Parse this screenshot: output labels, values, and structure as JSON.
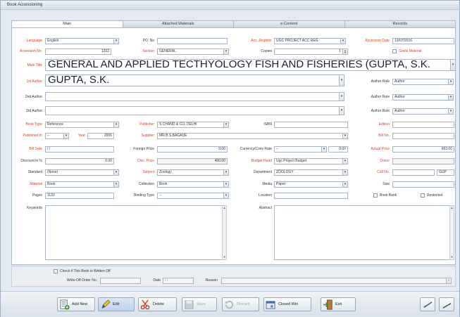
{
  "window": {
    "title": "Book Accessioning"
  },
  "tabs": [
    "Main",
    "Attached Materials",
    "e-Content",
    "Records"
  ],
  "fields": {
    "language": {
      "label": "Language",
      "value": "English"
    },
    "po_no": {
      "label": "PO. No",
      "value": ""
    },
    "acc_register": {
      "label": "Acc. Register",
      "value": "UGC PROJECT ACC REG"
    },
    "accession_date": {
      "label": "Accession Date",
      "value": "13/07/2016"
    },
    "accession_no": {
      "label": "Accession No.",
      "value": "1202"
    },
    "section": {
      "label": "Section",
      "value": "GENERAL"
    },
    "copies": {
      "label": "Copies",
      "value": "1"
    },
    "gratis_material": {
      "label": "Gratis Material"
    },
    "main_title": {
      "label": "Main Title",
      "value": "GENERAL AND APPLIED TECTHYOLOGY FISH AND FISHERIES (GUPTA, S.K."
    },
    "author1": {
      "label": "1st Author",
      "value": "GUPTA, S.K."
    },
    "author2": {
      "label": "2nd Author",
      "value": ""
    },
    "author3": {
      "label": "3rd Author",
      "value": ""
    },
    "author_role1": {
      "label": "Author Role",
      "value": "Author"
    },
    "author_role2": {
      "label": "Author Role",
      "value": "Author"
    },
    "author_role3": {
      "label": "Author Role",
      "value": "Author"
    },
    "book_type": {
      "label": "Book Type",
      "value": "Reference"
    },
    "publisher": {
      "label": "Publisher",
      "value": "S.CHAND & CO. DELHI"
    },
    "isbn": {
      "label": "ISBN",
      "value": ""
    },
    "edition": {
      "label": "Edition",
      "value": ""
    },
    "published_in": {
      "label": "Published In",
      "value": "--"
    },
    "year": {
      "label": "Year",
      "value": "2006"
    },
    "supplier": {
      "label": "Supplier",
      "value": "MR.B.S.BAGADE"
    },
    "bill_no": {
      "label": "Bill No.",
      "value": ""
    },
    "bill_date": {
      "label": "Bill Date",
      "value": "/ /"
    },
    "foreign_price": {
      "label": "Foreign Price",
      "value": "0.00"
    },
    "currency_conv_rate": {
      "label": "Currency/Conv Rate",
      "value": "--",
      "rate": "0.00"
    },
    "actual_price": {
      "label": "Actual Price",
      "value": "663.00"
    },
    "discount": {
      "label": "Discount in %",
      "value": "0.00"
    },
    "disc_price": {
      "label": "Disc. Price",
      "value": "400.00"
    },
    "budget_head": {
      "label": "Budget Head",
      "value": "Ugc Project Budget"
    },
    "donor": {
      "label": "Donor",
      "value": ""
    },
    "standard": {
      "label": "Standard",
      "value": "(None)"
    },
    "subject": {
      "label": "Subject",
      "value": "Zoology"
    },
    "department": {
      "label": "Department",
      "value": "ZOOLOGY"
    },
    "call_no": {
      "label": "Call No.",
      "value": "",
      "suffix": "GUP"
    },
    "material": {
      "label": "Material",
      "value": "Book"
    },
    "collection": {
      "label": "Collection",
      "value": "Book"
    },
    "media": {
      "label": "Media",
      "value": "Paper"
    },
    "size": {
      "label": "Size",
      "value": ""
    },
    "pages": {
      "label": "Pages",
      "value": "1133"
    },
    "binding_type": {
      "label": "Binding Type",
      "value": "--"
    },
    "location": {
      "label": "Location",
      "value": ""
    },
    "book_bank": {
      "label": "Book Bank"
    },
    "restricted": {
      "label": "Restricted"
    },
    "keywords": {
      "label": "Keywords",
      "value": ""
    },
    "abstract": {
      "label": "Abstract",
      "value": ""
    }
  },
  "writeoff": {
    "check_label": "Check if This Book is Written Off",
    "no_label": "Write-Off Order No.",
    "no_value": "",
    "date_label": "Date",
    "date_value": "/ /",
    "reason_label": "Reason",
    "reason_value": ""
  },
  "buttons": [
    {
      "label": "Add New",
      "icon": "add-new-icon",
      "state": "enabled"
    },
    {
      "label": "Edit",
      "icon": "edit-pencil-icon",
      "state": "pressed"
    },
    {
      "label": "Delete",
      "icon": "delete-scissors-icon",
      "state": "enabled"
    },
    {
      "label": "Save",
      "icon": "save-disk-icon",
      "state": "disabled"
    },
    {
      "label": "Discard",
      "icon": "discard-icon",
      "state": "disabled"
    },
    {
      "label": "Closed Win",
      "icon": "close-window-icon",
      "state": "enabled"
    },
    {
      "label": "Exit",
      "icon": "exit-door-icon",
      "state": "enabled"
    }
  ],
  "nav_icons": [
    "prev-record-icon",
    "next-record-icon"
  ],
  "colors": {
    "required_label": "#e23a1d",
    "panel_bg": "#e4eaf1",
    "field_border": "#a7b5c6"
  }
}
